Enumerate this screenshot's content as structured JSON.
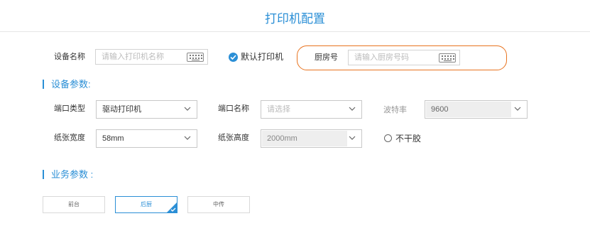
{
  "dialog": {
    "title": "打印机配置"
  },
  "device": {
    "name_label": "设备名称",
    "name_placeholder": "请输入打印机名称",
    "default_label": "默认打印机",
    "kitchen_label": "厨房号",
    "kitchen_placeholder": "请输入厨房号码"
  },
  "device_params": {
    "section_title": "设备参数:",
    "port_type_label": "端口类型",
    "port_type_value": "驱动打印机",
    "port_name_label": "端口名称",
    "port_name_placeholder": "请选择",
    "baud_label": "波特率",
    "baud_value": "9600",
    "paper_width_label": "纸张宽度",
    "paper_width_value": "58mm",
    "paper_height_label": "纸张高度",
    "paper_height_value": "2000mm",
    "non_adhesive_label": "不干胶"
  },
  "business_params": {
    "section_title": "业务参数 :",
    "options": [
      "前台",
      "后厨",
      "中传"
    ],
    "selected": "后厨"
  },
  "colors": {
    "accent": "#2b8fd6",
    "highlight": "#e8731f"
  }
}
